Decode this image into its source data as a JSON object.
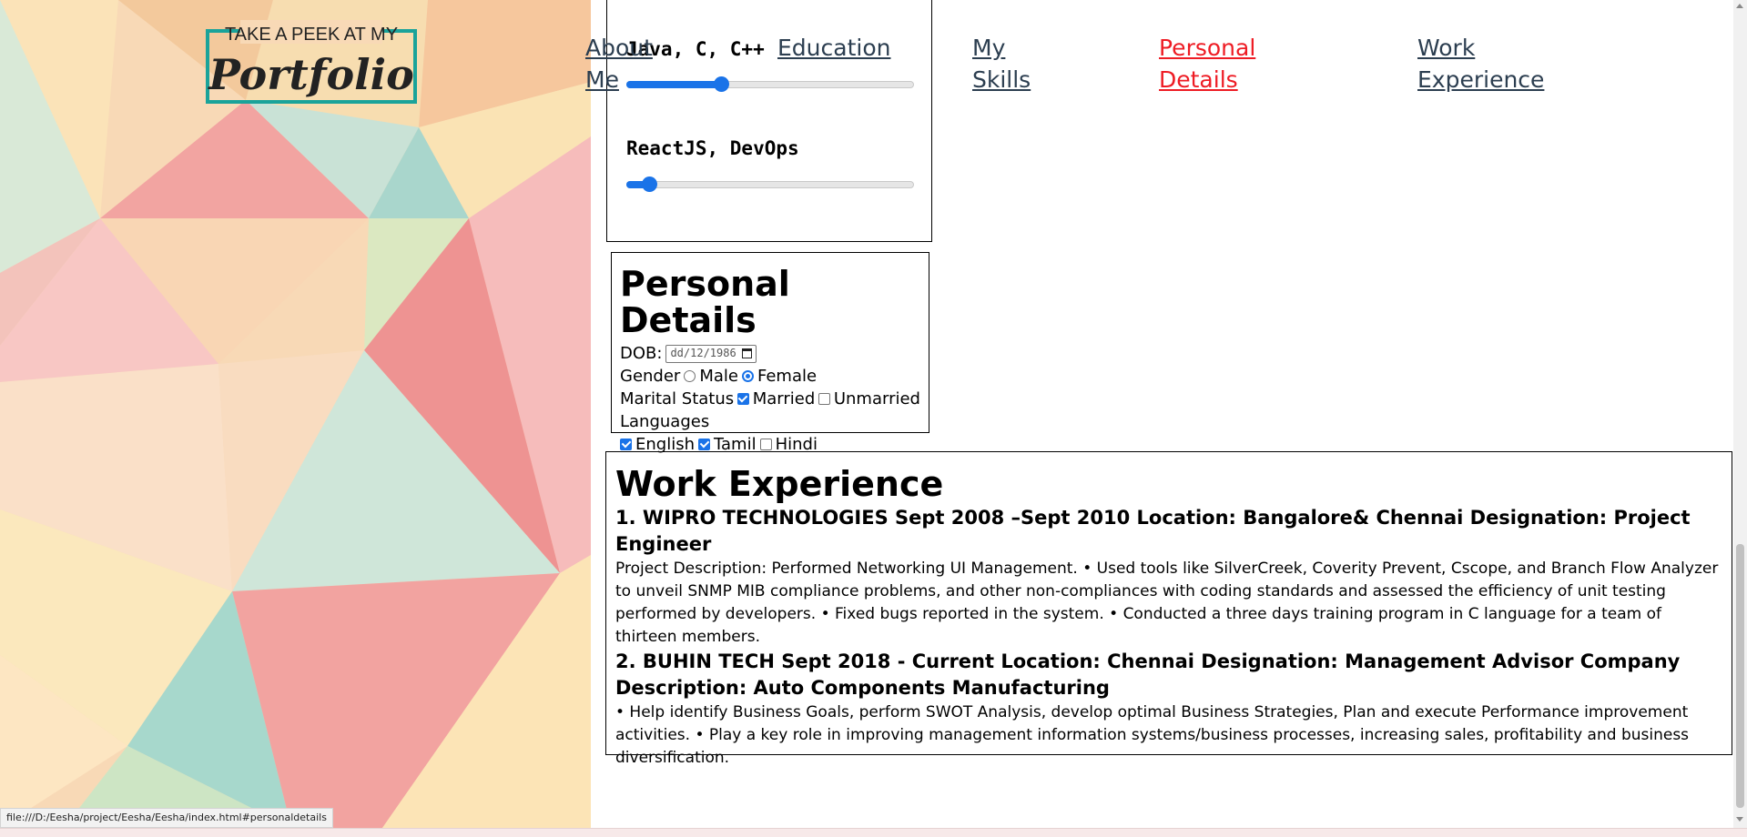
{
  "logo": {
    "tagline": "TAKE A PEEK AT MY",
    "word": "Portfolio"
  },
  "nav": [
    {
      "label": "About\nMe",
      "active": false
    },
    {
      "label": "Education",
      "active": false
    },
    {
      "label": "My\nSkills",
      "active": false
    },
    {
      "label": "Personal\nDetails",
      "active": true
    },
    {
      "label": "Work\nExperience",
      "active": false
    }
  ],
  "skills": [
    {
      "label": "Java, C, C++",
      "level": 0.33
    },
    {
      "label": "ReactJS, DevOps",
      "level": 0.08
    }
  ],
  "personal": {
    "title": "Personal Details",
    "dob_label": "DOB:",
    "dob_value": "dd/12/1986",
    "gender_label": "Gender",
    "gender_options": [
      "Male",
      "Female"
    ],
    "gender_selected": "Female",
    "marital_label": "Marital Status",
    "marital_options": [
      {
        "label": "Married",
        "checked": true
      },
      {
        "label": "Unmarried",
        "checked": false
      }
    ],
    "languages_label": "Languages",
    "languages": [
      {
        "label": "English",
        "checked": true
      },
      {
        "label": "Tamil",
        "checked": true
      },
      {
        "label": "Hindi",
        "checked": false
      }
    ]
  },
  "work": {
    "title": "Work Experience",
    "jobs": [
      {
        "title": "1. WIPRO TECHNOLOGIES Sept 2008 –Sept 2010 Location: Bangalore& Chennai Designation: Project Engineer",
        "description": "Project Description: Performed Networking UI Management. • Used tools like SilverCreek, Coverity Prevent, Cscope, and Branch Flow Analyzer to unveil SNMP MIB compliance problems, and other non-compliances with coding standards and assessed the efficiency of unit testing performed by developers. • Fixed bugs reported in the system. • Conducted a three days training program in C language for a team of thirteen members."
      },
      {
        "title": "2. BUHIN TECH Sept 2018 - Current Location: Chennai Designation: Management Advisor Company Description: Auto Components Manufacturing",
        "description": "• Help identify Business Goals, perform SWOT Analysis, develop optimal Business Strategies, Plan and execute Performance improvement activities. • Play a key role in improving management information systems/business processes, increasing sales, profitability and business diversification."
      }
    ]
  },
  "status_url": "file:///D:/Eesha/project/Eesha/Eesha/index.html#personaldetails",
  "colors": {
    "accent": "#1a73e8",
    "nav_active": "#ee1c24",
    "nav": "#2c3e50",
    "logo_teal": "#1aa39a"
  }
}
